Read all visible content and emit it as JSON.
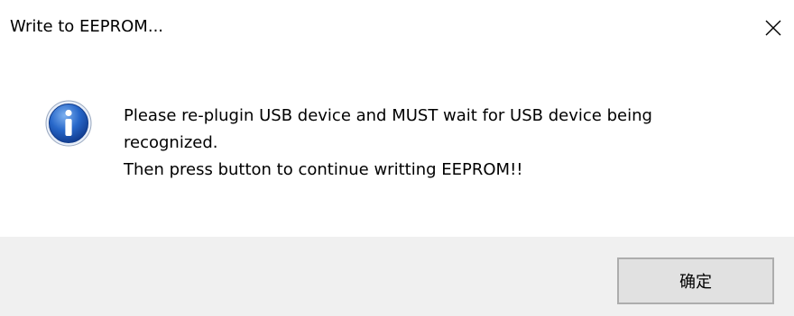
{
  "window": {
    "title": "Write to EEPROM...",
    "close_icon": "close-icon"
  },
  "message": {
    "icon": "info-icon",
    "line1": "Please re-plugin USB device and MUST wait for USB device being",
    "line2": "recognized.",
    "line3": "Then press button to continue writting EEPROM!!"
  },
  "footer": {
    "ok_label": "确定"
  },
  "colors": {
    "footer_bg": "#f0f0f0",
    "button_bg": "#e1e1e1",
    "button_border": "#adadad",
    "icon_blue": "#1c5fc2"
  }
}
